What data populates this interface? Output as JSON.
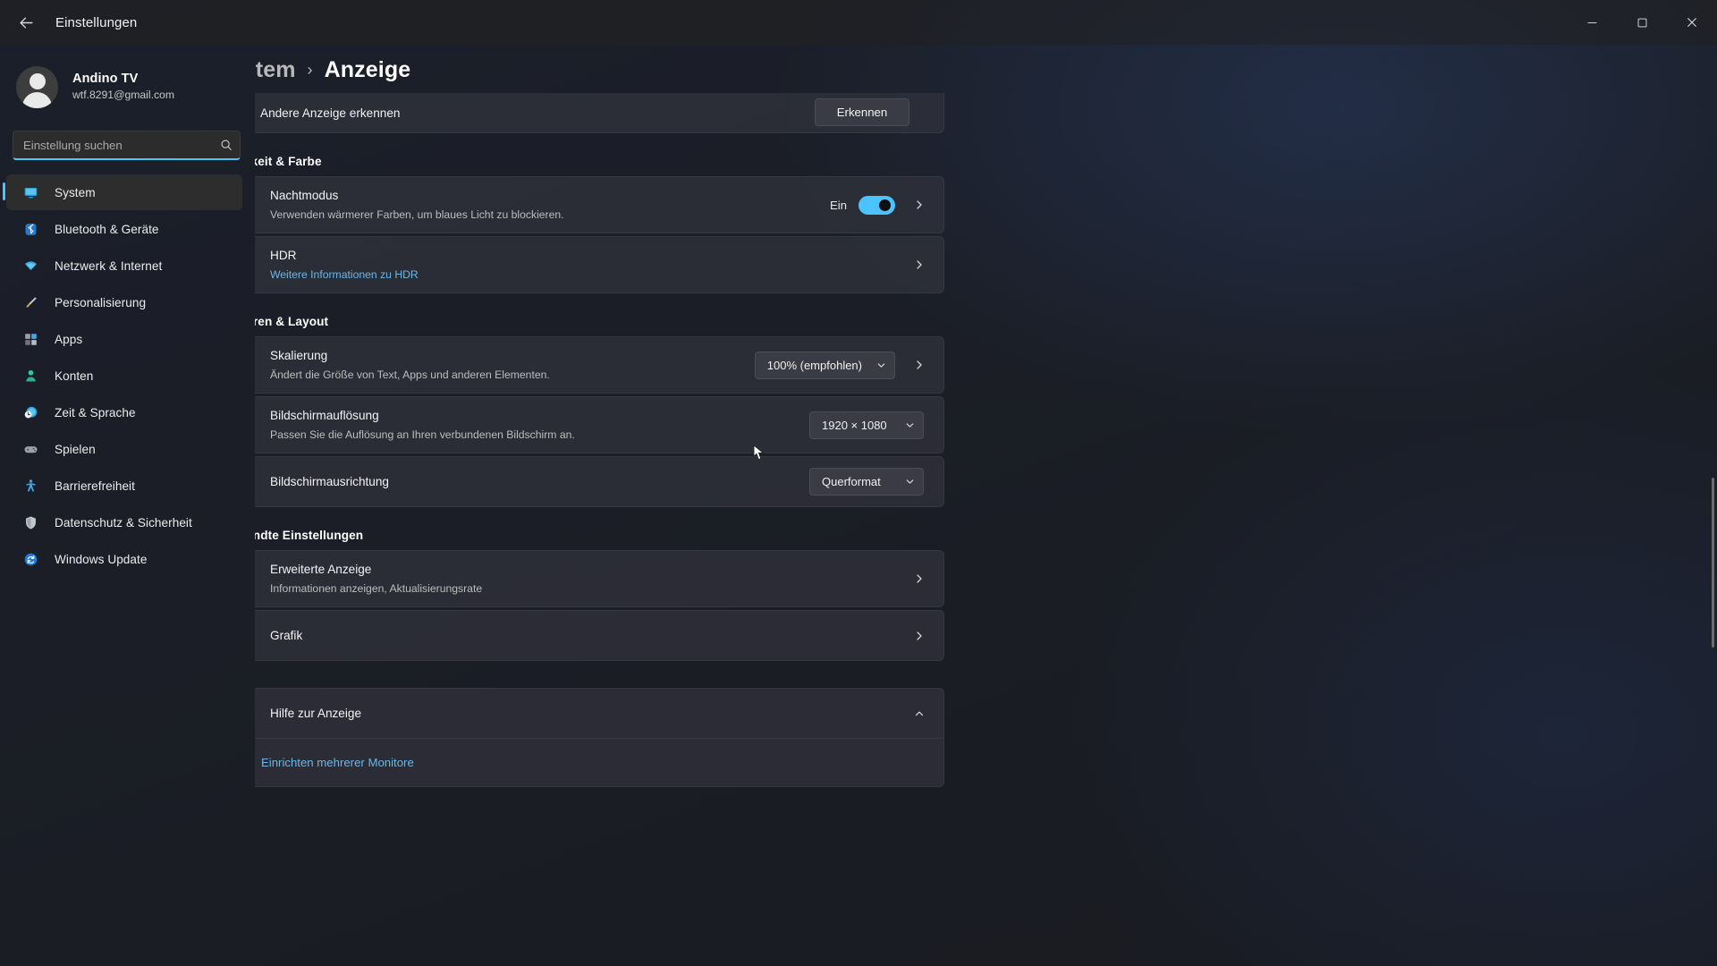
{
  "window": {
    "title": "Einstellungen",
    "back_icon": "arrow-left-icon",
    "minimize_icon": "minimize-icon",
    "maximize_icon": "maximize-icon",
    "close_icon": "close-icon"
  },
  "account": {
    "name": "Andino TV",
    "email": "wtf.8291@gmail.com",
    "avatar_icon": "user-avatar-icon"
  },
  "search": {
    "placeholder": "Einstellung suchen",
    "value": "",
    "icon": "search-icon"
  },
  "sidebar": {
    "items": [
      {
        "label": "System",
        "icon": "monitor-icon",
        "active": true
      },
      {
        "label": "Bluetooth & Geräte",
        "icon": "bluetooth-icon",
        "active": false
      },
      {
        "label": "Netzwerk & Internet",
        "icon": "wifi-icon",
        "active": false
      },
      {
        "label": "Personalisierung",
        "icon": "brush-icon",
        "active": false
      },
      {
        "label": "Apps",
        "icon": "apps-grid-icon",
        "active": false
      },
      {
        "label": "Konten",
        "icon": "person-icon",
        "active": false
      },
      {
        "label": "Zeit & Sprache",
        "icon": "clock-globe-icon",
        "active": false
      },
      {
        "label": "Spielen",
        "icon": "gamepad-icon",
        "active": false
      },
      {
        "label": "Barrierefreiheit",
        "icon": "accessibility-icon",
        "active": false
      },
      {
        "label": "Datenschutz & Sicherheit",
        "icon": "shield-icon",
        "active": false
      },
      {
        "label": "Windows Update",
        "icon": "update-refresh-icon",
        "active": false
      }
    ]
  },
  "breadcrumb": {
    "parent": "System",
    "separator": "›",
    "current": "Anzeige"
  },
  "main": {
    "detect_row": {
      "label": "Andere Anzeige erkennen",
      "button_label": "Erkennen"
    },
    "sections": [
      {
        "title": "Helligkeit & Farbe",
        "rows": [
          {
            "title": "Nachtmodus",
            "subtitle": "Verwenden wärmerer Farben, um blaues Licht zu blockieren.",
            "icon": "brightness-sun-icon",
            "state_label": "Ein",
            "toggle_on": true,
            "chevron": "chevron-right-icon"
          },
          {
            "title": "HDR",
            "subtitle": "Weitere Informationen zu HDR",
            "subtitle_is_link": true,
            "icon": "hdr-icon",
            "chevron": "chevron-right-icon"
          }
        ]
      },
      {
        "title": "Skalieren & Layout",
        "rows": [
          {
            "title": "Skalierung",
            "subtitle": "Ändert die Größe von Text, Apps und anderen Elementen.",
            "icon": "scale-icon",
            "dropdown_value": "100% (empfohlen)",
            "chevron": "chevron-right-icon"
          },
          {
            "title": "Bildschirmauflösung",
            "subtitle": "Passen Sie die Auflösung an Ihren verbundenen Bildschirm an.",
            "icon": "resolution-icon",
            "dropdown_value": "1920 × 1080"
          },
          {
            "title": "Bildschirmausrichtung",
            "subtitle": "",
            "icon": "orientation-icon",
            "dropdown_value": "Querformat"
          }
        ]
      },
      {
        "title": "Verwandte Einstellungen",
        "rows": [
          {
            "title": "Erweiterte Anzeige",
            "subtitle": "Informationen anzeigen, Aktualisierungsrate",
            "icon": "display-laptop-icon",
            "chevron": "chevron-right-icon"
          },
          {
            "title": "Grafik",
            "subtitle": "",
            "icon": "graphics-card-icon",
            "chevron": "chevron-right-icon"
          }
        ]
      }
    ],
    "help": {
      "title": "Hilfe zur Anzeige",
      "icon": "globe-help-icon",
      "chevron": "chevron-up-icon",
      "links": [
        "Einrichten mehrerer Monitore"
      ]
    }
  },
  "colors": {
    "accent": "#4cc2ff",
    "link": "#69b7e8",
    "card": "#2f313b",
    "sidebar_active": "#2d2d2d"
  }
}
